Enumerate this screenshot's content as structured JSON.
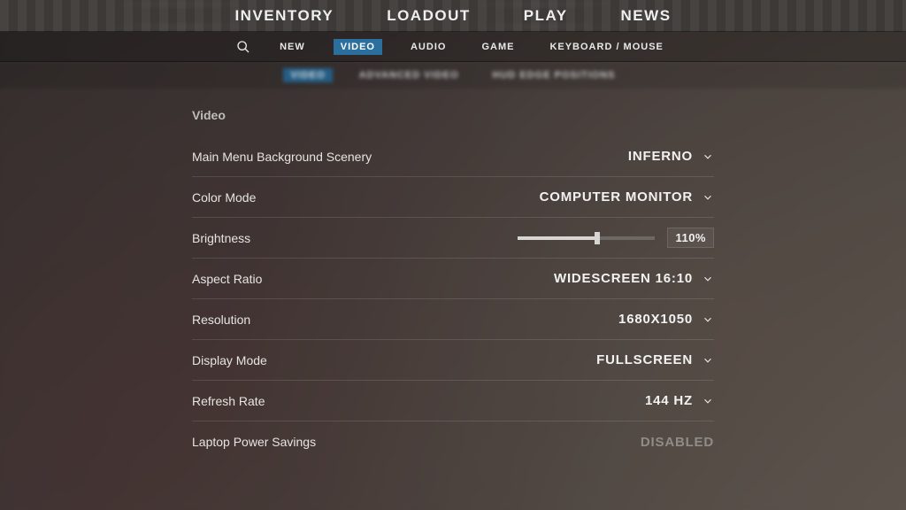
{
  "topnav": {
    "items": [
      "INVENTORY",
      "LOADOUT",
      "PLAY",
      "NEWS"
    ]
  },
  "catbar": {
    "items": [
      "NEW",
      "VIDEO",
      "AUDIO",
      "GAME",
      "KEYBOARD / MOUSE"
    ],
    "active_index": 1
  },
  "subbar": {
    "items": [
      "VIDEO",
      "ADVANCED VIDEO",
      "HUD EDGE POSITIONS"
    ],
    "active_index": 0
  },
  "section_title": "Video",
  "rows": {
    "bg_scenery": {
      "label": "Main Menu Background Scenery",
      "value": "INFERNO"
    },
    "color_mode": {
      "label": "Color Mode",
      "value": "COMPUTER MONITOR"
    },
    "brightness": {
      "label": "Brightness",
      "percent": 58,
      "text": "110%"
    },
    "aspect": {
      "label": "Aspect Ratio",
      "value": "WIDESCREEN 16:10"
    },
    "resolution": {
      "label": "Resolution",
      "value": "1680X1050"
    },
    "display_mode": {
      "label": "Display Mode",
      "value": "FULLSCREEN"
    },
    "refresh": {
      "label": "Refresh Rate",
      "value": "144 HZ"
    },
    "laptop": {
      "label": "Laptop Power Savings",
      "value": "DISABLED"
    }
  }
}
